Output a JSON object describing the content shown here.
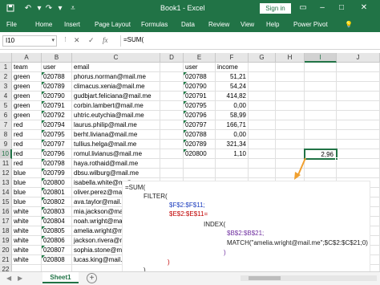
{
  "window": {
    "title": "Book1 - Excel",
    "sign_in": "Sign in",
    "accent": "#217346"
  },
  "ribbon_tabs": [
    "File",
    "Home",
    "Insert",
    "Page Layout",
    "Formulas",
    "Data",
    "Review",
    "View",
    "Help",
    "Power Pivot"
  ],
  "formula_bar": {
    "name_box": "I10",
    "formula": "=SUM("
  },
  "columns": [
    "A",
    "B",
    "C",
    "D",
    "E",
    "F",
    "G",
    "H",
    "I",
    "J"
  ],
  "selected_column": "I",
  "rows": [
    "1",
    "2",
    "3",
    "4",
    "5",
    "6",
    "7",
    "8",
    "9",
    "10",
    "11",
    "12",
    "13",
    "14",
    "15",
    "16",
    "17",
    "18",
    "19",
    "20",
    "21",
    "22"
  ],
  "selected_row": "10",
  "table_left": {
    "headers": [
      "team",
      "user",
      "email"
    ],
    "rows": [
      [
        "green",
        "020788",
        "phorus.norman@mail.me"
      ],
      [
        "green",
        "020789",
        "climacus.xenia@mail.me"
      ],
      [
        "green",
        "020790",
        "gudbjart.feliciana@mail.me"
      ],
      [
        "green",
        "020791",
        "corbin.lambert@mail.me"
      ],
      [
        "green",
        "020792",
        "uhtric.eutychia@mail.me"
      ],
      [
        "red",
        "020794",
        "laurus.philip@mail.me"
      ],
      [
        "red",
        "020795",
        "berht.liviana@mail.me"
      ],
      [
        "red",
        "020797",
        "tullius.helga@mail.me"
      ],
      [
        "red",
        "020796",
        "romul.livianus@mail.me"
      ],
      [
        "red",
        "020798",
        "haya.rothaid@mail.me"
      ],
      [
        "blue",
        "020799",
        "dbsu.wilburg@mail.me"
      ],
      [
        "blue",
        "020800",
        "isabella.white@mail.me"
      ],
      [
        "blue",
        "020801",
        "oliver.perez@mail.me"
      ],
      [
        "blue",
        "020802",
        "ava.taylor@mail.me"
      ],
      [
        "white",
        "020803",
        "mia.jackson@mail.me"
      ],
      [
        "white",
        "020804",
        "noah.wright@mail.me"
      ],
      [
        "white",
        "020805",
        "amelia.wright@mail.me"
      ],
      [
        "white",
        "020806",
        "jackson.rivera@mail.me"
      ],
      [
        "white",
        "020807",
        "sophia.stone@mail.me"
      ],
      [
        "white",
        "020808",
        "lucas.king@mail.me"
      ]
    ]
  },
  "table_right": {
    "headers": [
      "user",
      "income"
    ],
    "rows": [
      [
        "020788",
        "51,21"
      ],
      [
        "020790",
        "54,24"
      ],
      [
        "020791",
        "414,82"
      ],
      [
        "020795",
        "0,00"
      ],
      [
        "020796",
        "58,99"
      ],
      [
        "020797",
        "166,71"
      ],
      [
        "020788",
        "0,00"
      ],
      [
        "020789",
        "321,34"
      ],
      [
        "020800",
        "1,10"
      ]
    ]
  },
  "active_cell_value": "2,96",
  "callout": {
    "lines": [
      "=SUM(",
      "FILTER(",
      "$F$2:$F$11;",
      "$E$2:$E$11=",
      "INDEX(",
      "$B$2:$B$21;",
      "MATCH(\"amelia.wright@mail.me\";$C$2:$C$21;0)",
      ")",
      ")",
      ")"
    ]
  },
  "sheet_tab": "Sheet1"
}
